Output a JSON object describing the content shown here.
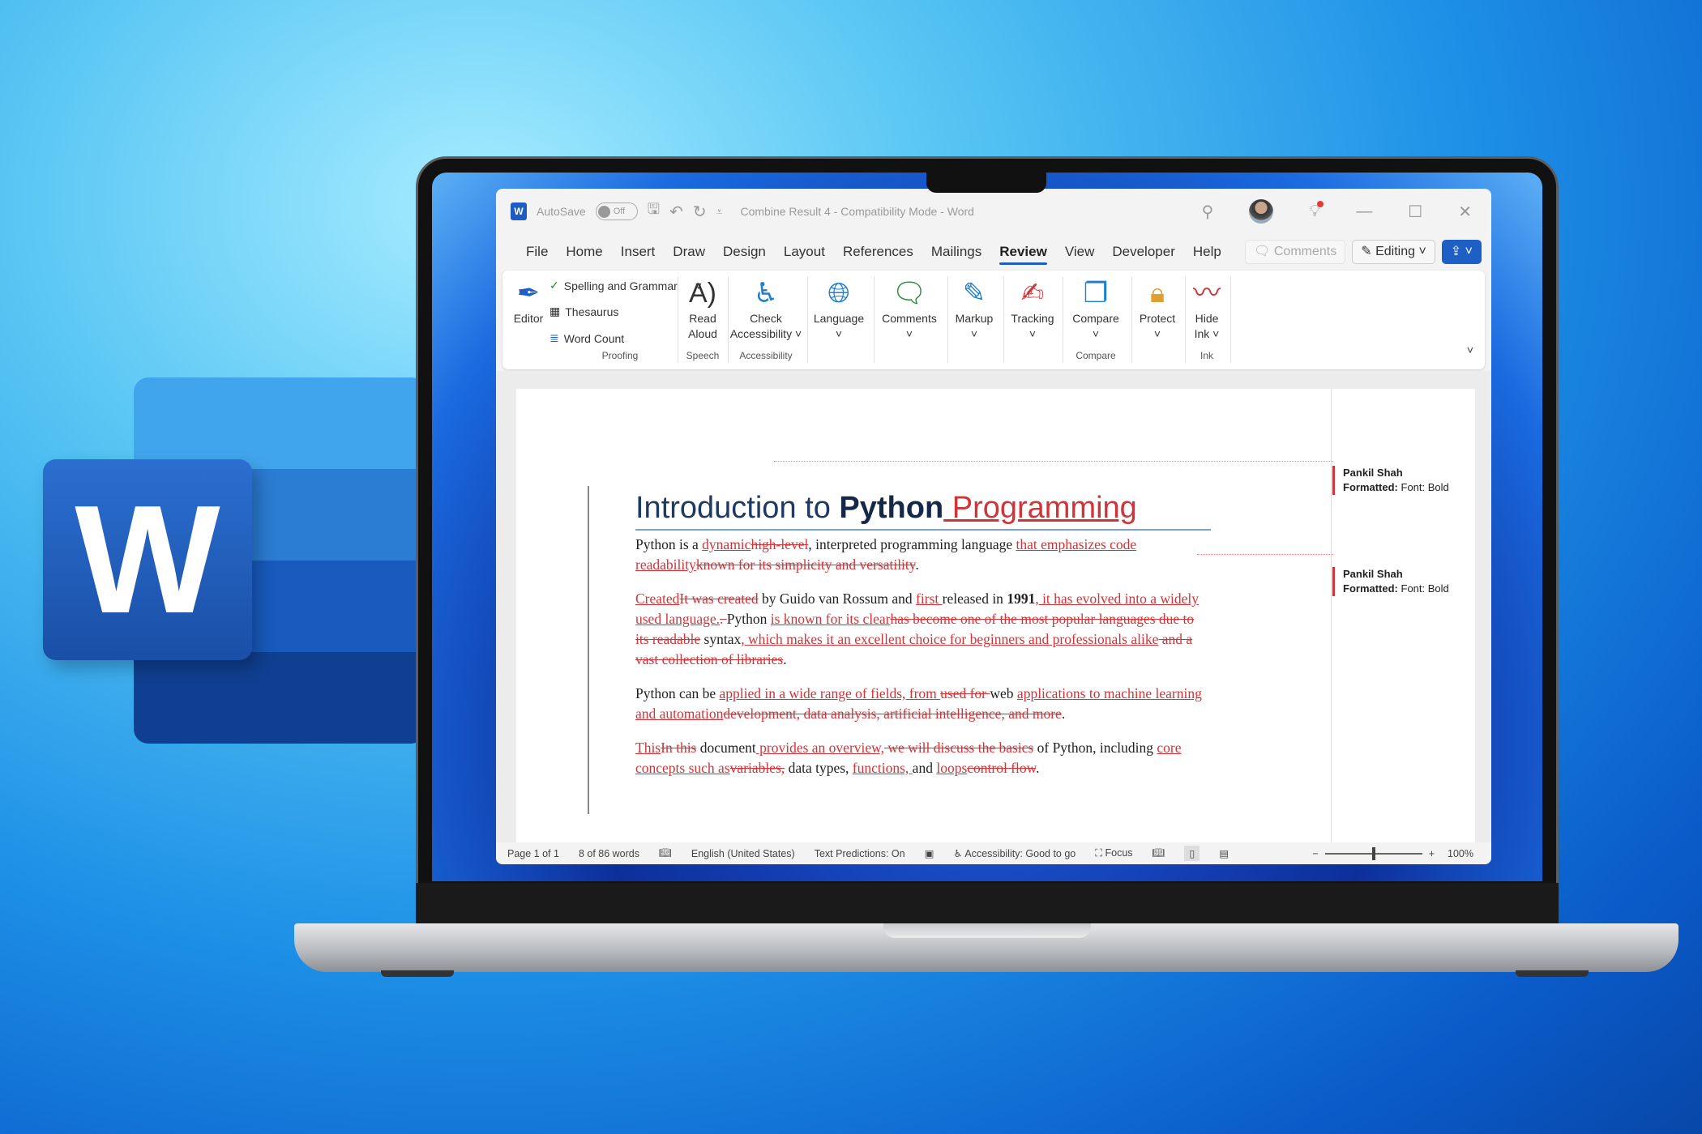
{
  "logo": {
    "letter": "W",
    "colors": [
      "#41a5ee",
      "#2b7cd3",
      "#185abd",
      "#103f91"
    ]
  },
  "titlebar": {
    "app_icon": "W",
    "autosave_label": "AutoSave",
    "autosave_state": "Off",
    "title": "Combine Result 4  -  Compatibility Mode  -  Word"
  },
  "tabs": [
    "File",
    "Home",
    "Insert",
    "Draw",
    "Design",
    "Layout",
    "References",
    "Mailings",
    "Review",
    "View",
    "Developer",
    "Help"
  ],
  "active_tab": "Review",
  "tab_buttons": {
    "comments": "Comments",
    "editing": "Editing"
  },
  "ribbon": {
    "editor": "Editor",
    "spelling": "Spelling and Grammar",
    "thesaurus": "Thesaurus",
    "word_count": "Word Count",
    "proofing": "Proofing",
    "read_aloud_1": "Read",
    "read_aloud_2": "Aloud",
    "speech": "Speech",
    "check_1": "Check",
    "check_2": "Accessibility",
    "accessibility": "Accessibility",
    "language": "Language",
    "comments": "Comments",
    "markup": "Markup",
    "tracking": "Tracking",
    "compare": "Compare",
    "compare_group": "Compare",
    "protect": "Protect",
    "hide_1": "Hide",
    "hide_2": "Ink",
    "ink": "Ink"
  },
  "document": {
    "title": {
      "plain": "Introduction to ",
      "bold": "Python",
      "inserted": " Programming"
    },
    "paragraphs": [
      [
        [
          "Python is a ",
          "p"
        ],
        [
          "dynamic",
          "i"
        ],
        [
          "high-level",
          "d"
        ],
        [
          ", interpreted programming language ",
          "p"
        ],
        [
          "that emphasizes code readability",
          "i"
        ],
        [
          "known for its simplicity and versatility",
          "d"
        ],
        [
          ".",
          "p"
        ]
      ],
      [
        [
          "Created",
          "i"
        ],
        [
          "It was created",
          "d"
        ],
        [
          " by Guido van Rossum and ",
          "p"
        ],
        [
          "first ",
          "i"
        ],
        [
          "released in ",
          "p"
        ],
        [
          "1991",
          "b"
        ],
        [
          ", it has evolved into a widely used language.",
          "i"
        ],
        [
          ". ",
          "d"
        ],
        [
          "Python ",
          "p"
        ],
        [
          "is known for its clear",
          "i"
        ],
        [
          "has become one of the most popular languages due to its readable",
          "d"
        ],
        [
          " syntax",
          "p"
        ],
        [
          ", which makes it an excellent choice for beginners and professionals alike",
          "i"
        ],
        [
          " and a vast collection of libraries",
          "d"
        ],
        [
          ".",
          "p"
        ]
      ],
      [
        [
          "Python can be ",
          "p"
        ],
        [
          "applied in a wide range of fields, from ",
          "i"
        ],
        [
          "used for ",
          "d"
        ],
        [
          "web ",
          "p"
        ],
        [
          "applications to machine learning and automation",
          "i"
        ],
        [
          "development, data analysis, artificial intelligence, and more",
          "d"
        ],
        [
          ".",
          "p"
        ]
      ],
      [
        [
          "This",
          "i"
        ],
        [
          "In this",
          "d"
        ],
        [
          " document",
          "p"
        ],
        [
          " provides an overview,",
          "i"
        ],
        [
          " we will discuss the basics",
          "d"
        ],
        [
          " of Python, including ",
          "p"
        ],
        [
          "core concepts such as",
          "i"
        ],
        [
          "variables,",
          "d"
        ],
        [
          " data types, ",
          "p"
        ],
        [
          "functions, ",
          "i"
        ],
        [
          "and ",
          "p"
        ],
        [
          "loops",
          "i"
        ],
        [
          "control flow",
          "d"
        ],
        [
          ".",
          "p"
        ]
      ]
    ],
    "comments": [
      {
        "author": "Pankil Shah",
        "label": "Formatted:",
        "detail": " Font: Bold"
      },
      {
        "author": "Pankil Shah",
        "label": "Formatted:",
        "detail": " Font: Bold"
      }
    ]
  },
  "status": {
    "page": "Page 1 of 1",
    "words": "8 of 86 words",
    "language": "English (United States)",
    "predictions": "Text Predictions: On",
    "accessibility": "Accessibility: Good to go",
    "focus": "Focus",
    "zoom": "100%",
    "zoom_minus": "−",
    "zoom_plus": "+"
  },
  "colors": {
    "accent": "#1e5fc6",
    "revision": "#d13438"
  }
}
